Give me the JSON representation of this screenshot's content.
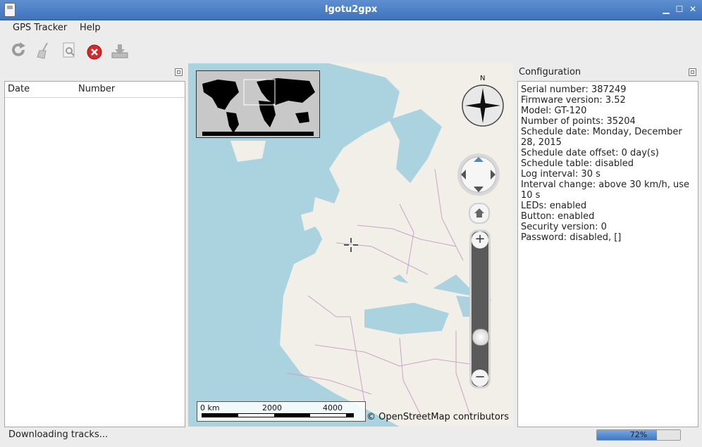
{
  "window": {
    "title": "Igotu2gpx"
  },
  "menu": {
    "gps_tracker": "GPS Tracker",
    "help": "Help"
  },
  "toolbar": {
    "buttons": [
      {
        "name": "reload",
        "icon": "reload-icon"
      },
      {
        "name": "clear",
        "icon": "broom-icon"
      },
      {
        "name": "info",
        "icon": "document-search-icon"
      },
      {
        "name": "cancel",
        "icon": "cancel-icon"
      },
      {
        "name": "download",
        "icon": "download-icon"
      }
    ]
  },
  "tracks": {
    "columns": [
      "Date",
      "Number"
    ]
  },
  "map": {
    "scale": {
      "zero": "0 km",
      "mid": "2000",
      "max": "4000"
    },
    "compass_n": "N",
    "attribution": "© OpenStreetMap contributors",
    "zoom_level": 0.22
  },
  "config": {
    "title": "Configuration",
    "lines": [
      "Serial number: 387249",
      "Firmware version: 3.52",
      "Model: GT-120",
      "Number of points: 35204",
      "Schedule date: Monday, December",
      "28, 2015",
      "Schedule date offset: 0 day(s)",
      "Schedule table: disabled",
      "Log interval: 30 s",
      "Interval change: above 30 km/h, use",
      "10 s",
      "LEDs: enabled",
      "Button: enabled",
      "Security version: 0",
      "Password: disabled, []"
    ]
  },
  "status": {
    "text": "Downloading tracks...",
    "progress_label": "72%",
    "progress": 0.72
  },
  "colors": {
    "titlebar": "#4a7fc7",
    "sea": "#aad3df",
    "land": "#f2efe9",
    "border": "#c9a3c9"
  }
}
